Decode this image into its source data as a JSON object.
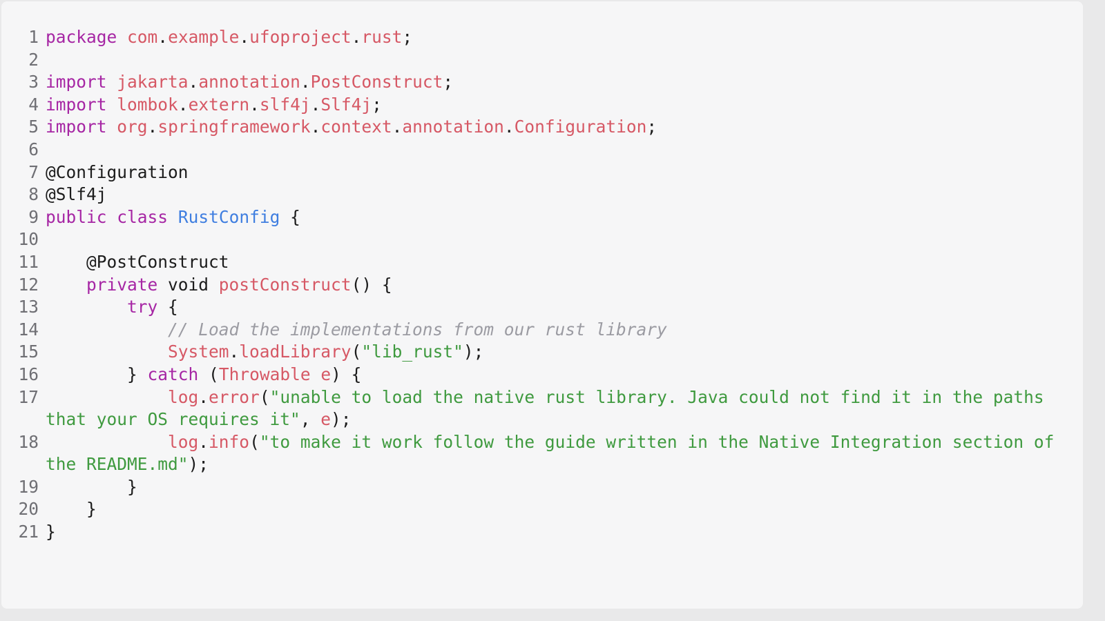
{
  "editor": {
    "lines": [
      {
        "n": "1",
        "tokens": [
          {
            "t": "package",
            "c": "kw"
          },
          {
            "t": " ",
            "c": "pu"
          },
          {
            "t": "com",
            "c": "pk"
          },
          {
            "t": ".",
            "c": "pu"
          },
          {
            "t": "example",
            "c": "pk"
          },
          {
            "t": ".",
            "c": "pu"
          },
          {
            "t": "ufoproject",
            "c": "pk"
          },
          {
            "t": ".",
            "c": "pu"
          },
          {
            "t": "rust",
            "c": "pk"
          },
          {
            "t": ";",
            "c": "pu"
          }
        ]
      },
      {
        "n": "2",
        "tokens": []
      },
      {
        "n": "3",
        "tokens": [
          {
            "t": "import",
            "c": "kw"
          },
          {
            "t": " ",
            "c": "pu"
          },
          {
            "t": "jakarta",
            "c": "pk"
          },
          {
            "t": ".",
            "c": "pu"
          },
          {
            "t": "annotation",
            "c": "pk"
          },
          {
            "t": ".",
            "c": "pu"
          },
          {
            "t": "PostConstruct",
            "c": "pk"
          },
          {
            "t": ";",
            "c": "pu"
          }
        ]
      },
      {
        "n": "4",
        "tokens": [
          {
            "t": "import",
            "c": "kw"
          },
          {
            "t": " ",
            "c": "pu"
          },
          {
            "t": "lombok",
            "c": "pk"
          },
          {
            "t": ".",
            "c": "pu"
          },
          {
            "t": "extern",
            "c": "pk"
          },
          {
            "t": ".",
            "c": "pu"
          },
          {
            "t": "slf4j",
            "c": "pk"
          },
          {
            "t": ".",
            "c": "pu"
          },
          {
            "t": "Slf4j",
            "c": "pk"
          },
          {
            "t": ";",
            "c": "pu"
          }
        ]
      },
      {
        "n": "5",
        "tokens": [
          {
            "t": "import",
            "c": "kw"
          },
          {
            "t": " ",
            "c": "pu"
          },
          {
            "t": "org",
            "c": "pk"
          },
          {
            "t": ".",
            "c": "pu"
          },
          {
            "t": "springframework",
            "c": "pk"
          },
          {
            "t": ".",
            "c": "pu"
          },
          {
            "t": "context",
            "c": "pk"
          },
          {
            "t": ".",
            "c": "pu"
          },
          {
            "t": "annotation",
            "c": "pk"
          },
          {
            "t": ".",
            "c": "pu"
          },
          {
            "t": "Configuration",
            "c": "pk"
          },
          {
            "t": ";",
            "c": "pu"
          }
        ]
      },
      {
        "n": "6",
        "tokens": []
      },
      {
        "n": "7",
        "tokens": [
          {
            "t": "@Configuration",
            "c": "an"
          }
        ]
      },
      {
        "n": "8",
        "tokens": [
          {
            "t": "@Slf4j",
            "c": "an"
          }
        ]
      },
      {
        "n": "9",
        "tokens": [
          {
            "t": "public",
            "c": "kw"
          },
          {
            "t": " ",
            "c": "pu"
          },
          {
            "t": "class",
            "c": "kw"
          },
          {
            "t": " ",
            "c": "pu"
          },
          {
            "t": "RustConfig",
            "c": "cl"
          },
          {
            "t": " {",
            "c": "pu"
          }
        ]
      },
      {
        "n": "10",
        "tokens": []
      },
      {
        "n": "11",
        "tokens": [
          {
            "t": "    @PostConstruct",
            "c": "an"
          }
        ]
      },
      {
        "n": "12",
        "tokens": [
          {
            "t": "    ",
            "c": "pu"
          },
          {
            "t": "private",
            "c": "kw"
          },
          {
            "t": " void ",
            "c": "pu"
          },
          {
            "t": "postConstruct",
            "c": "fn"
          },
          {
            "t": "() {",
            "c": "pu"
          }
        ]
      },
      {
        "n": "13",
        "tokens": [
          {
            "t": "        ",
            "c": "pu"
          },
          {
            "t": "try",
            "c": "kw"
          },
          {
            "t": " {",
            "c": "pu"
          }
        ]
      },
      {
        "n": "14",
        "tokens": [
          {
            "t": "            ",
            "c": "pu"
          },
          {
            "t": "// Load the implementations from our rust library",
            "c": "cm"
          }
        ]
      },
      {
        "n": "15",
        "tokens": [
          {
            "t": "            ",
            "c": "pu"
          },
          {
            "t": "System",
            "c": "pk"
          },
          {
            "t": ".",
            "c": "pu"
          },
          {
            "t": "loadLibrary",
            "c": "fn"
          },
          {
            "t": "(",
            "c": "pu"
          },
          {
            "t": "\"lib_rust\"",
            "c": "st"
          },
          {
            "t": ");",
            "c": "pu"
          }
        ]
      },
      {
        "n": "16",
        "tokens": [
          {
            "t": "        } ",
            "c": "pu"
          },
          {
            "t": "catch",
            "c": "kw"
          },
          {
            "t": " (",
            "c": "pu"
          },
          {
            "t": "Throwable",
            "c": "pk"
          },
          {
            "t": " ",
            "c": "pu"
          },
          {
            "t": "e",
            "c": "va"
          },
          {
            "t": ") {",
            "c": "pu"
          }
        ]
      },
      {
        "n": "17",
        "tokens": [
          {
            "t": "            ",
            "c": "pu"
          },
          {
            "t": "log",
            "c": "va"
          },
          {
            "t": ".",
            "c": "pu"
          },
          {
            "t": "error",
            "c": "fn"
          },
          {
            "t": "(",
            "c": "pu"
          },
          {
            "t": "\"unable to load the native rust library. Java could not find it in the paths that your OS requires it\"",
            "c": "st"
          },
          {
            "t": ", ",
            "c": "pu"
          },
          {
            "t": "e",
            "c": "va"
          },
          {
            "t": ");",
            "c": "pu"
          }
        ]
      },
      {
        "n": "18",
        "tokens": [
          {
            "t": "            ",
            "c": "pu"
          },
          {
            "t": "log",
            "c": "va"
          },
          {
            "t": ".",
            "c": "pu"
          },
          {
            "t": "info",
            "c": "fn"
          },
          {
            "t": "(",
            "c": "pu"
          },
          {
            "t": "\"to make it work follow the guide written in the Native Integration section of the README.md\"",
            "c": "st"
          },
          {
            "t": ");",
            "c": "pu"
          }
        ]
      },
      {
        "n": "19",
        "tokens": [
          {
            "t": "        }",
            "c": "pu"
          }
        ]
      },
      {
        "n": "20",
        "tokens": [
          {
            "t": "    }",
            "c": "pu"
          }
        ]
      },
      {
        "n": "21",
        "tokens": [
          {
            "t": "}",
            "c": "pu"
          }
        ]
      }
    ]
  },
  "colors": {
    "keyword": "#a626a4",
    "package": "#d65865",
    "class": "#3f7ee0",
    "string": "#3f9a3f",
    "comment": "#9b9ba2",
    "text": "#1c1c1c",
    "line_number": "#6f6f74",
    "background": "#f6f6f7"
  }
}
